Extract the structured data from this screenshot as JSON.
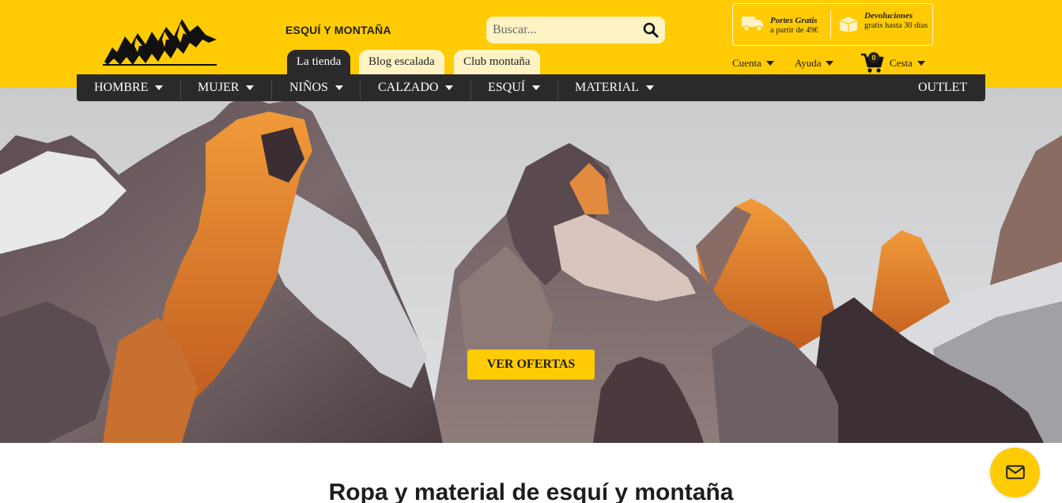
{
  "brand": {
    "name": "ESQUÍ Y MONTAÑA",
    "logo_icon": "mountain-logo-icon"
  },
  "search": {
    "placeholder": "Buscar...",
    "icon": "search-icon"
  },
  "benefits": [
    {
      "icon": "truck-icon",
      "title": "Portes Gratis",
      "subtitle": "a partir de 49€"
    },
    {
      "icon": "box-icon",
      "title": "Devoluciones",
      "subtitle": "gratis hasta 30 días"
    }
  ],
  "tabs": [
    {
      "label": "La tienda",
      "active": true
    },
    {
      "label": "Blog escalada",
      "active": false
    },
    {
      "label": "Club montaña",
      "active": false
    }
  ],
  "utility": {
    "account": "Cuenta",
    "help": "Ayuda",
    "cart": "Cesta",
    "cart_count": "0",
    "cart_icon": "cart-icon"
  },
  "nav": {
    "items": [
      "HOMBRE",
      "MUJER",
      "NIÑOS",
      "CALZADO",
      "ESQUÍ",
      "MATERIAL"
    ],
    "outlet": "OUTLET"
  },
  "hero": {
    "cta": "VER OFERTAS"
  },
  "section": {
    "title": "Ropa y material de esquí y montaña"
  },
  "chat": {
    "icon": "envelope-icon"
  },
  "colors": {
    "accent": "#ffcb05",
    "dark": "#2a2a2a",
    "light_yellow": "#fff3c4"
  }
}
